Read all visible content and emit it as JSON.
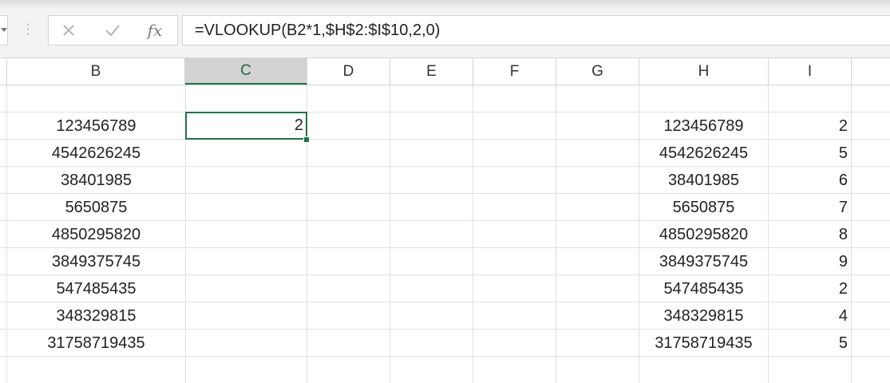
{
  "formula_bar": {
    "cancel_icon": "close-icon",
    "enter_icon": "check-icon",
    "fx_label": "fx",
    "formula": "=VLOOKUP(B2*1,$H$2:$I$10,2,0)"
  },
  "columns": [
    "B",
    "C",
    "D",
    "E",
    "F",
    "G",
    "H",
    "I"
  ],
  "selected_column": "C",
  "active_cell": {
    "ref": "C2",
    "value": "2"
  },
  "sheet": {
    "column_B": [
      "123456789",
      "4542626245",
      "38401985",
      "5650875",
      "4850295820",
      "3849375745",
      "547485435",
      "348329815",
      "31758719435"
    ],
    "column_H": [
      "123456789",
      "4542626245",
      "38401985",
      "5650875",
      "4850295820",
      "3849375745",
      "547485435",
      "348329815",
      "31758719435"
    ],
    "column_I": [
      "2",
      "5",
      "6",
      "7",
      "8",
      "9",
      "2",
      "4",
      "5"
    ]
  },
  "colors": {
    "accent_green": "#217346",
    "gridline": "#e1e1e1",
    "header_selected": "#d2d2d2"
  }
}
